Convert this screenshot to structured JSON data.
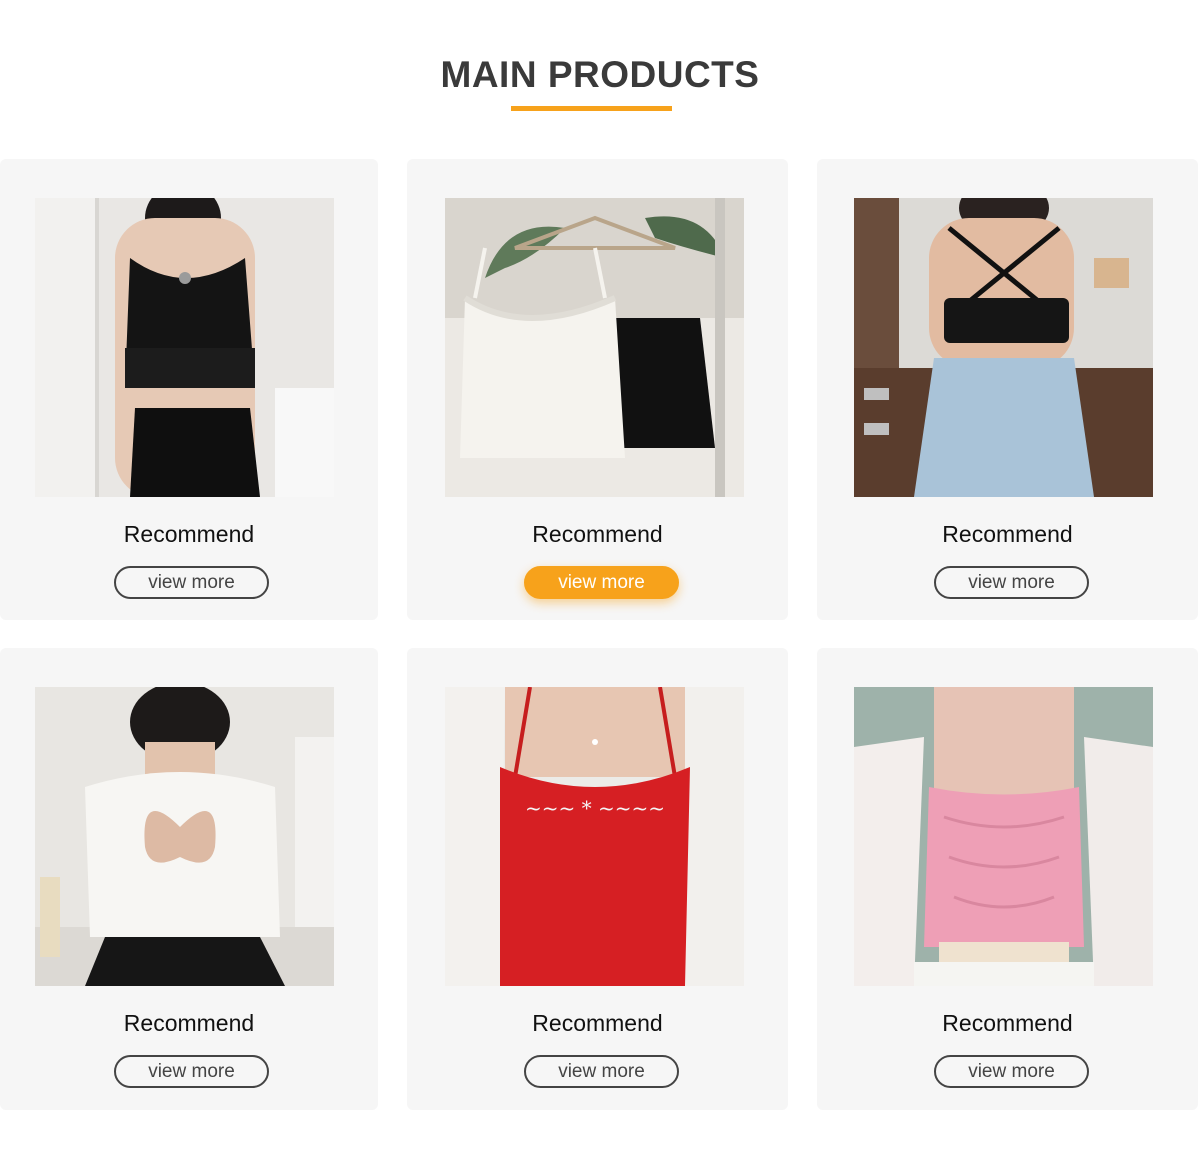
{
  "section": {
    "title": "MAIN PRODUCTS"
  },
  "colors": {
    "accent": "#f7a21b",
    "card_bg": "#f6f6f6",
    "title": "#3a3a3a"
  },
  "products": [
    {
      "label": "Recommend",
      "button": "view more",
      "image": "black-cami-crop-top-photo",
      "active": false
    },
    {
      "label": "Recommend",
      "button": "view more",
      "image": "white-and-black-lace-bralette-photo",
      "active": true
    },
    {
      "label": "Recommend",
      "button": "view more",
      "image": "black-cross-back-crop-top-photo",
      "active": false
    },
    {
      "label": "Recommend",
      "button": "view more",
      "image": "white-butterfly-back-tee-photo",
      "active": false
    },
    {
      "label": "Recommend",
      "button": "view more",
      "image": "red-print-cami-photo",
      "active": false
    },
    {
      "label": "Recommend",
      "button": "view more",
      "image": "pink-ruched-cami-photo",
      "active": false
    }
  ]
}
